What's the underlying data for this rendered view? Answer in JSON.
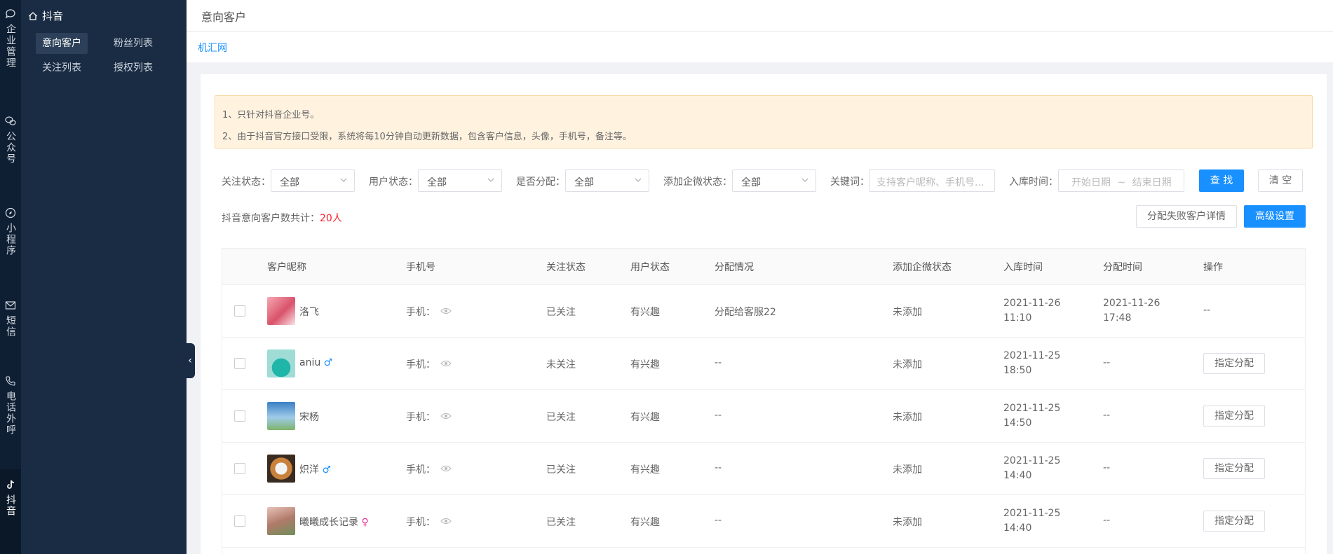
{
  "rail": [
    {
      "icon": "chat-bubble-icon",
      "label": "企业管理"
    },
    {
      "icon": "wechat-icon",
      "label": "公众号"
    },
    {
      "icon": "compass-icon",
      "label": "小程序"
    },
    {
      "icon": "mail-icon",
      "label": "短信"
    },
    {
      "icon": "phone-icon",
      "label": "电话外呼"
    },
    {
      "icon": "tiktok-icon",
      "label": "抖音"
    }
  ],
  "submenu": {
    "title": "抖音",
    "items": [
      "意向客户",
      "粉丝列表",
      "关注列表",
      "授权列表"
    ]
  },
  "header": {
    "title": "意向客户"
  },
  "breadcrumb": "机汇网",
  "notice": [
    "1、只针对抖音企业号。",
    "2、由于抖音官方接口受限，系统将每10分钟自动更新数据，包含客户信息，头像，手机号，备注等。"
  ],
  "filters": {
    "follow_label": "关注状态：",
    "follow_value": "全部",
    "user_label": "用户状态：",
    "user_value": "全部",
    "assigned_label": "是否分配：",
    "assigned_value": "全部",
    "wecom_label": "添加企微状态：",
    "wecom_value": "全部",
    "keyword_label": "关键词：",
    "keyword_placeholder": "支持客户昵称、手机号...",
    "date_label": "入库时间：",
    "date_start": "开始日期",
    "date_sep": "~",
    "date_end": "结束日期",
    "search_btn": "查 找",
    "clear_btn": "清 空"
  },
  "summary": {
    "label": "抖音意向客户数共计：",
    "count": "20人"
  },
  "actions": {
    "fail_detail": "分配失败客户详情",
    "advanced": "高级设置"
  },
  "table": {
    "columns": [
      "客户昵称",
      "手机号",
      "关注状态",
      "用户状态",
      "分配情况",
      "添加企微状态",
      "入库时间",
      "分配时间",
      "操作"
    ],
    "phone_prefix": "手机：",
    "assign_btn": "指定分配",
    "rows": [
      {
        "name": "洛飞",
        "gender": "",
        "follow": "已关注",
        "status": "有兴趣",
        "assign": "分配给客服22",
        "wecom": "未添加",
        "in_date": "2021-11-26",
        "in_time": "11:10",
        "as_date": "2021-11-26",
        "as_time": "17:48",
        "op": "--"
      },
      {
        "name": "aniu",
        "gender": "♂",
        "follow": "未关注",
        "status": "有兴趣",
        "assign": "--",
        "wecom": "未添加",
        "in_date": "2021-11-25",
        "in_time": "18:50",
        "as_date": "--",
        "as_time": "",
        "op": ""
      },
      {
        "name": "宋杨",
        "gender": "",
        "follow": "已关注",
        "status": "有兴趣",
        "assign": "--",
        "wecom": "未添加",
        "in_date": "2021-11-25",
        "in_time": "14:50",
        "as_date": "--",
        "as_time": "",
        "op": ""
      },
      {
        "name": "炽洋",
        "gender": "♂",
        "follow": "已关注",
        "status": "有兴趣",
        "assign": "--",
        "wecom": "未添加",
        "in_date": "2021-11-25",
        "in_time": "14:40",
        "as_date": "--",
        "as_time": "",
        "op": ""
      },
      {
        "name": "曦曦成长记录",
        "gender": "♀",
        "follow": "已关注",
        "status": "有兴趣",
        "assign": "--",
        "wecom": "未添加",
        "in_date": "2021-11-25",
        "in_time": "14:40",
        "as_date": "--",
        "as_time": "",
        "op": ""
      }
    ]
  },
  "colors": {
    "primary": "#1890ff",
    "sidebar": "#1a2c43",
    "rail": "#0f1f33",
    "notice_bg": "#fff3e0",
    "count": "#f5222d"
  }
}
